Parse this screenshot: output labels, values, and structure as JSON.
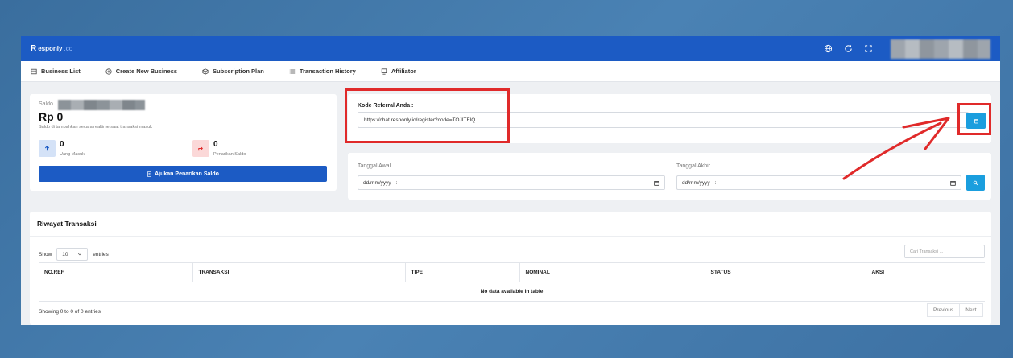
{
  "brand": {
    "name": "esponly",
    "initial": "R",
    "suffix": ".co"
  },
  "topbar": {
    "icons": [
      "globe-icon",
      "refresh-icon",
      "fullscreen-icon"
    ]
  },
  "nav": {
    "items": [
      {
        "label": "Business List",
        "icon": "building-icon"
      },
      {
        "label": "Create New Business",
        "icon": "plus-circle-icon"
      },
      {
        "label": "Subscription Plan",
        "icon": "box-icon"
      },
      {
        "label": "Transaction History",
        "icon": "list-icon"
      },
      {
        "label": "Affiliator",
        "icon": "monitor-icon"
      }
    ]
  },
  "saldo": {
    "label": "Saldo",
    "amount": "Rp 0",
    "description": "Saldo di tambahkan secara realtime saat transaksi masuk",
    "in": {
      "value": "0",
      "label": "Uang Masuk"
    },
    "out": {
      "value": "0",
      "label": "Penarikan Saldo"
    },
    "button_label": "Ajukan Penarikan Saldo"
  },
  "referral": {
    "label": "Kode Referral Anda :",
    "link": "https://chat.responly.io/register?code=TOJITFIQ"
  },
  "dates": {
    "start_label": "Tanggal Awal",
    "start_placeholder": "dd/mm/yyyy --:--",
    "end_label": "Tanggal Akhir",
    "end_placeholder": "dd/mm/yyyy --:--"
  },
  "transactions": {
    "title": "Riwayat Transaksi",
    "show_label": "Show",
    "entries_value": "10",
    "entries_label": "entries",
    "search_placeholder": "Cari Transaksi ...",
    "columns": [
      "NO.REF",
      "TRANSAKSI",
      "TIPE",
      "NOMINAL",
      "STATUS",
      "AKSI"
    ],
    "empty_text": "No data available in table",
    "info": "Showing 0 to 0 of 0 entries",
    "previous_label": "Previous",
    "next_label": "Next"
  },
  "colors": {
    "primary": "#1c5bc4",
    "accent": "#1a9ede",
    "highlight": "#e02a2a"
  }
}
